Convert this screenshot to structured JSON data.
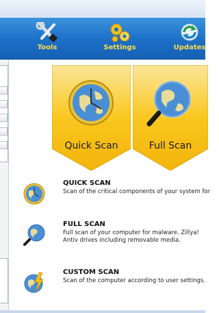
{
  "toolbar": {
    "buttons": [
      {
        "label": "Tools",
        "icon": "tools-icon"
      },
      {
        "label": "Settings",
        "icon": "gears-icon"
      },
      {
        "label": "Updates",
        "icon": "refresh-icon"
      }
    ]
  },
  "tiles": [
    {
      "label": "Quick Scan",
      "icon": "globe-clock-icon"
    },
    {
      "label": "Full Scan",
      "icon": "globe-magnifier-icon"
    }
  ],
  "scans": [
    {
      "title": "QUICK SCAN",
      "description": "Scan of the critical components of your system for",
      "icon": "globe-clock-icon"
    },
    {
      "title": "FULL SCAN",
      "description": "Full scan of your computer for malware. Zillya! Antiv drives including removable media.",
      "icon": "globe-magnifier-icon"
    },
    {
      "title": "CUSTOM SCAN",
      "description": "Scan of the computer according to user settings.",
      "icon": "globe-lightning-icon"
    }
  ],
  "colors": {
    "toolbar": "#1c6fc6",
    "toolbar_label": "#ffdd44",
    "tile_yellow": "#f9c71e"
  }
}
